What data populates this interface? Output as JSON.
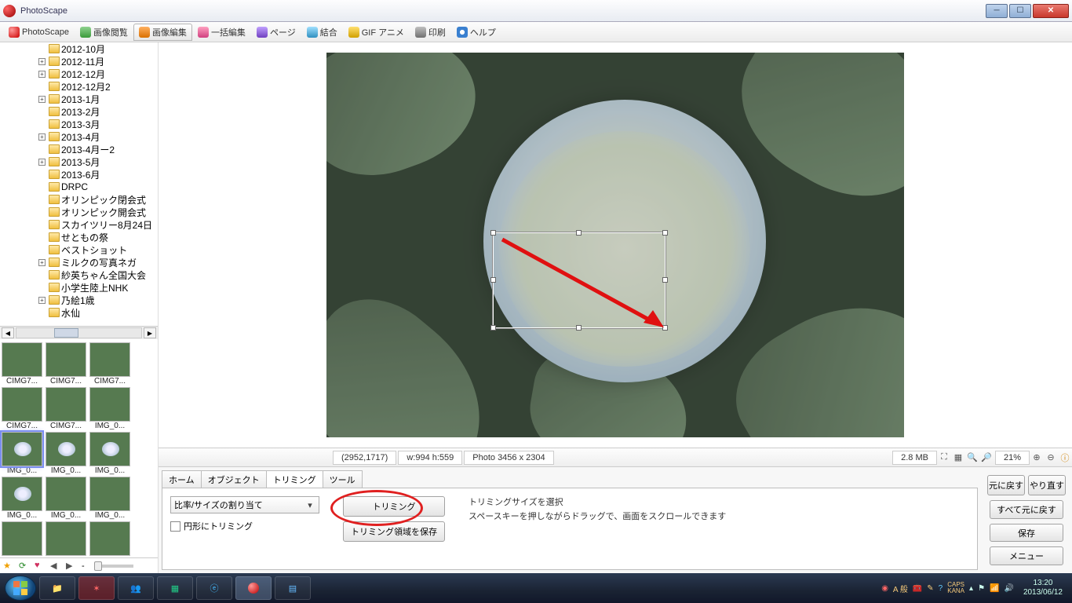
{
  "window": {
    "title": "PhotoScape"
  },
  "toolbar": {
    "tabs": [
      "PhotoScape",
      "画像閲覧",
      "画像編集",
      "一括編集",
      "ページ",
      "結合",
      "GIF アニメ",
      "印刷",
      "ヘルプ"
    ],
    "active_index": 2
  },
  "tree": {
    "nodes": [
      {
        "indent": 2,
        "exp": "",
        "label": "2012-10月"
      },
      {
        "indent": 2,
        "exp": "+",
        "label": "2012-11月"
      },
      {
        "indent": 2,
        "exp": "+",
        "label": "2012-12月"
      },
      {
        "indent": 2,
        "exp": "",
        "label": "2012-12月2"
      },
      {
        "indent": 2,
        "exp": "+",
        "label": "2013-1月"
      },
      {
        "indent": 2,
        "exp": "",
        "label": "2013-2月"
      },
      {
        "indent": 2,
        "exp": "",
        "label": "2013-3月"
      },
      {
        "indent": 2,
        "exp": "+",
        "label": "2013-4月"
      },
      {
        "indent": 2,
        "exp": "",
        "label": "2013-4月ー2"
      },
      {
        "indent": 2,
        "exp": "+",
        "label": "2013-5月"
      },
      {
        "indent": 2,
        "exp": "",
        "label": "2013-6月"
      },
      {
        "indent": 2,
        "exp": "",
        "label": "DRPC"
      },
      {
        "indent": 2,
        "exp": "",
        "label": "オリンピック閉会式"
      },
      {
        "indent": 2,
        "exp": "",
        "label": "オリンピック開会式"
      },
      {
        "indent": 2,
        "exp": "",
        "label": "スカイツリー8月24日"
      },
      {
        "indent": 2,
        "exp": "",
        "label": "せともの祭"
      },
      {
        "indent": 2,
        "exp": "",
        "label": "ベストショット"
      },
      {
        "indent": 2,
        "exp": "+",
        "label": "ミルクの写真ネガ"
      },
      {
        "indent": 2,
        "exp": "",
        "label": "紗英ちゃん全国大会"
      },
      {
        "indent": 2,
        "exp": "",
        "label": "小学生陸上NHK"
      },
      {
        "indent": 2,
        "exp": "+",
        "label": "乃絵1歳"
      },
      {
        "indent": 2,
        "exp": "",
        "label": "水仙"
      }
    ]
  },
  "thumbnails": [
    {
      "cap": "CIMG7..."
    },
    {
      "cap": "CIMG7..."
    },
    {
      "cap": "CIMG7..."
    },
    {
      "cap": "CIMG7..."
    },
    {
      "cap": "CIMG7..."
    },
    {
      "cap": "IMG_0..."
    },
    {
      "cap": "IMG_0...",
      "sel": true
    },
    {
      "cap": "IMG_0..."
    },
    {
      "cap": "IMG_0..."
    },
    {
      "cap": "IMG_0..."
    },
    {
      "cap": "IMG_0..."
    },
    {
      "cap": "IMG_0..."
    }
  ],
  "status": {
    "coords": "(2952,1717)",
    "selsize": "w:994 h:559",
    "photosize": "Photo 3456 x 2304",
    "filesize": "2.8 MB",
    "zoom": "21%"
  },
  "subtabs": {
    "items": [
      "ホーム",
      "オブジェクト",
      "トリミング",
      "ツール"
    ],
    "active_index": 2
  },
  "crop": {
    "ratio_label": "比率/サイズの割り当て",
    "trim_btn": "トリミング",
    "save_region_btn": "トリミング領域を保存",
    "ellipse_label": "円形にトリミング",
    "help1": "トリミングサイズを選択",
    "help2": "スペースキーを押しながらドラッグで、画面をスクロールできます"
  },
  "rightbtns": {
    "undo": "元に戻す",
    "redo": "やり直す",
    "undo_all": "すべて元に戻す",
    "save": "保存",
    "menu": "メニュー"
  },
  "ime": {
    "mode": "A 般",
    "caps": "CAPS",
    "kana": "KANA"
  },
  "clock": {
    "time": "13:20",
    "date": "2013/06/12"
  }
}
